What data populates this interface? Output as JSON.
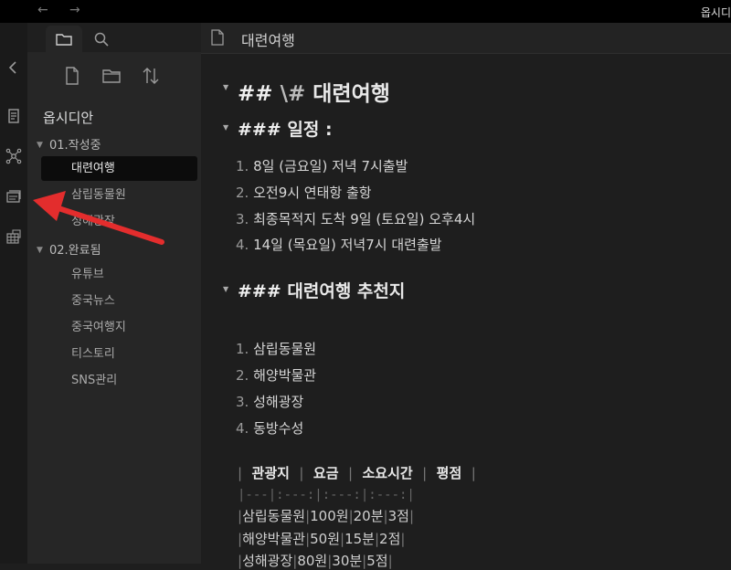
{
  "titlebar": {
    "back": "←",
    "forward": "→",
    "app_title": "옵시디"
  },
  "ribbon": {
    "icons": [
      "collapse-icon",
      "file-switcher-icon",
      "graph-icon",
      "cards-icon",
      "grid-icon"
    ]
  },
  "sidebar": {
    "tabs": [
      "folder-icon",
      "search-icon"
    ],
    "tools": [
      "new-note-icon",
      "new-folder-icon",
      "sort-icon"
    ],
    "vault_name": "옵시디안",
    "folders": [
      {
        "name": "01.작성중",
        "expanded": true,
        "files": [
          "대련여행",
          "삼립동물원",
          "성해광장"
        ]
      },
      {
        "name": "02.완료됨",
        "expanded": true,
        "files": [
          "유튜브",
          "중국뉴스",
          "중국여행지",
          "티스토리",
          "SNS관리"
        ]
      }
    ],
    "active_file": "대련여행"
  },
  "editor": {
    "tab_title": "대련여행",
    "h2": {
      "hash": "##",
      "escape": "\\#",
      "text": "대련여행"
    },
    "sections": [
      {
        "hash": "###",
        "text": "일정 :",
        "items": [
          "8일 (금요일) 저녁 7시출발",
          "오전9시 연태항 출항",
          "최종목적지 도착 9일 (토요일) 오후4시",
          "14일 (목요일) 저녁7시 대련출발"
        ]
      },
      {
        "hash": "###",
        "text": "대련여행 추천지",
        "items": [
          "삼립동물원",
          "해양박물관",
          "성해광장",
          "동방수성"
        ]
      }
    ],
    "table": {
      "header": [
        "관광지",
        "요금",
        "소요시간",
        "평점"
      ],
      "separator": "|---|:---:|:---:|:---:|",
      "rows": [
        [
          "삼립동물원",
          "100원",
          "20분",
          "3점"
        ],
        [
          "해양박물관",
          "50원",
          "15분",
          "2점"
        ],
        [
          "성해광장",
          "80원",
          "30분",
          "5점"
        ]
      ]
    }
  },
  "colors": {
    "background": "#1e1e1e",
    "sidebar": "#262626",
    "ribbon": "#1a1a1a",
    "arrow": "#e32d2d"
  }
}
